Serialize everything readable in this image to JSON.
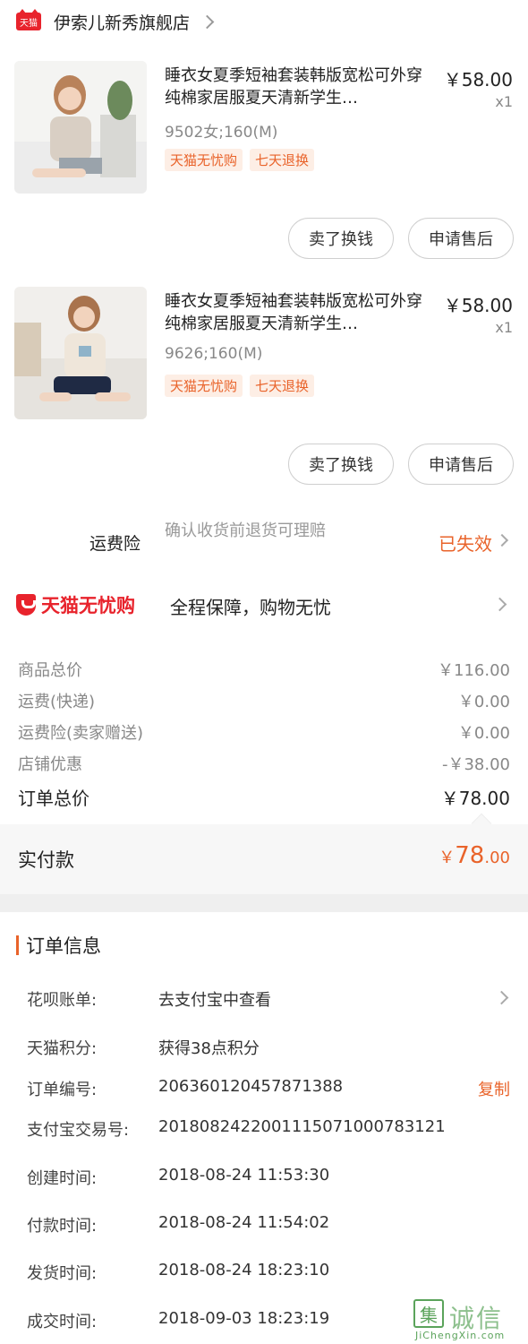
{
  "shop": {
    "name": "伊索儿新秀旗舰店",
    "logo_text": "天猫"
  },
  "products": [
    {
      "title": "睡衣女夏季短袖套装韩版宽松可外穿纯棉家居服夏天清新学生…",
      "price": "￥58.00",
      "qty": "x1",
      "sku": "9502女;160(M)",
      "tags": [
        "天猫无忧购",
        "七天退换"
      ],
      "btn_sell": "卖了换钱",
      "btn_aftersale": "申请售后"
    },
    {
      "title": "睡衣女夏季短袖套装韩版宽松可外穿纯棉家居服夏天清新学生…",
      "price": "￥58.00",
      "qty": "x1",
      "sku": "9626;160(M)",
      "tags": [
        "天猫无忧购",
        "七天退换"
      ],
      "btn_sell": "卖了换钱",
      "btn_aftersale": "申请售后"
    }
  ],
  "shipping_insurance": {
    "label": "运费险",
    "desc": "确认收货前退货可理赔",
    "status": "已失效"
  },
  "worry_free": {
    "brand": "天猫无忧购",
    "slogan": "全程保障，购物无忧"
  },
  "summary": {
    "rows": [
      {
        "label": "商品总价",
        "value": "￥116.00"
      },
      {
        "label": "运费(快递)",
        "value": "￥0.00"
      },
      {
        "label": "运费险(卖家赠送)",
        "value": "￥0.00"
      },
      {
        "label": "店铺优惠",
        "value": "-￥38.00"
      }
    ],
    "total_label": "订单总价",
    "total_value": "￥78.00",
    "paid_label": "实付款",
    "paid_symbol": "￥",
    "paid_int": "78",
    "paid_dec": ".00"
  },
  "order_info": {
    "title": "订单信息",
    "rows": [
      {
        "label": "花呗账单:",
        "value": "去支付宝中查看"
      },
      {
        "label": "天猫积分:",
        "value": "获得38点积分"
      },
      {
        "label": "订单编号:",
        "value": "206360120457871388",
        "action": "复制"
      },
      {
        "label": "支付宝交易号:",
        "value": "2018082422001115071000783121"
      },
      {
        "label": "创建时间:",
        "value": "2018-08-24 11:53:30"
      },
      {
        "label": "付款时间:",
        "value": "2018-08-24 11:54:02"
      },
      {
        "label": "发货时间:",
        "value": "2018-08-24 18:23:10"
      },
      {
        "label": "成交时间:",
        "value": "2018-09-03 18:23:19"
      }
    ]
  },
  "watermark": {
    "char": "集",
    "text": "诚信",
    "sub": "JiChengXin.com"
  },
  "colors": {
    "accent": "#e9632a",
    "brand_red": "#e8232c"
  }
}
